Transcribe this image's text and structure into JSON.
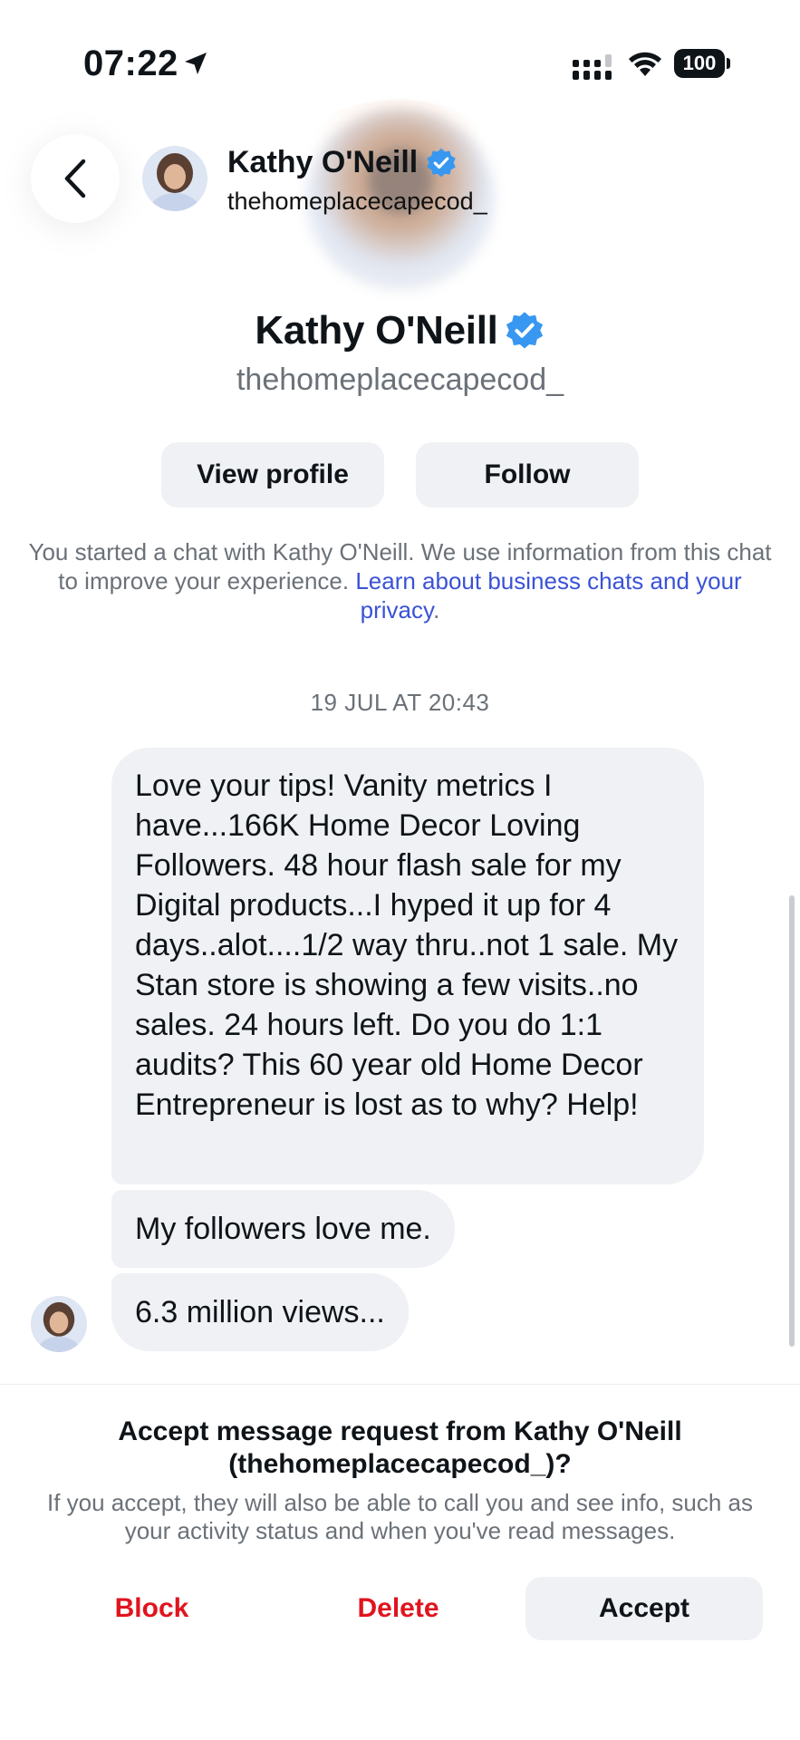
{
  "status_bar": {
    "time": "07:22",
    "battery": "100",
    "icons": [
      "location-arrow-icon",
      "cellular-signal-icon",
      "wifi-icon",
      "battery-icon"
    ]
  },
  "header": {
    "back_icon": "chevron-left-icon",
    "name": "Kathy O'Neill",
    "handle": "thehomeplacecapecod_",
    "verified_icon": "verified-badge-icon"
  },
  "profile": {
    "name": "Kathy O'Neill",
    "handle": "thehomeplacecapecod_",
    "view_profile_label": "View profile",
    "follow_label": "Follow"
  },
  "disclosure": {
    "text": "You started a chat with Kathy O'Neill. We use information from this chat to improve your experience. ",
    "link_text": "Learn about business chats and your privacy",
    "trailing": "."
  },
  "conversation": {
    "timestamp": "19 JUL AT 20:43",
    "messages": [
      {
        "text": "Love your tips! Vanity metrics I have...166K Home Decor Loving Followers. 48 hour flash sale for my Digital products...I hyped it up for 4 days..alot....1/2 way thru..not 1 sale. My Stan store is showing a few visits..no sales. 24 hours left. Do you do 1:1 audits? This 60 year old Home Decor Entrepreneur is lost as to why? Help!"
      },
      {
        "text": "My followers love me."
      },
      {
        "text": "6.3 million views..."
      }
    ]
  },
  "request": {
    "title": "Accept message request from Kathy O'Neill (thehomeplacecapecod_)?",
    "body": "If you accept, they will also be able to call you and see info, such as your activity status and when you've read messages.",
    "block_label": "Block",
    "delete_label": "Delete",
    "accept_label": "Accept"
  },
  "colors": {
    "accent_blue": "#3a52d6",
    "verified_blue": "#3897f0",
    "destructive_red": "#e0141e",
    "bubble_gray": "#eff1f4",
    "secondary_text": "#6b7178"
  }
}
